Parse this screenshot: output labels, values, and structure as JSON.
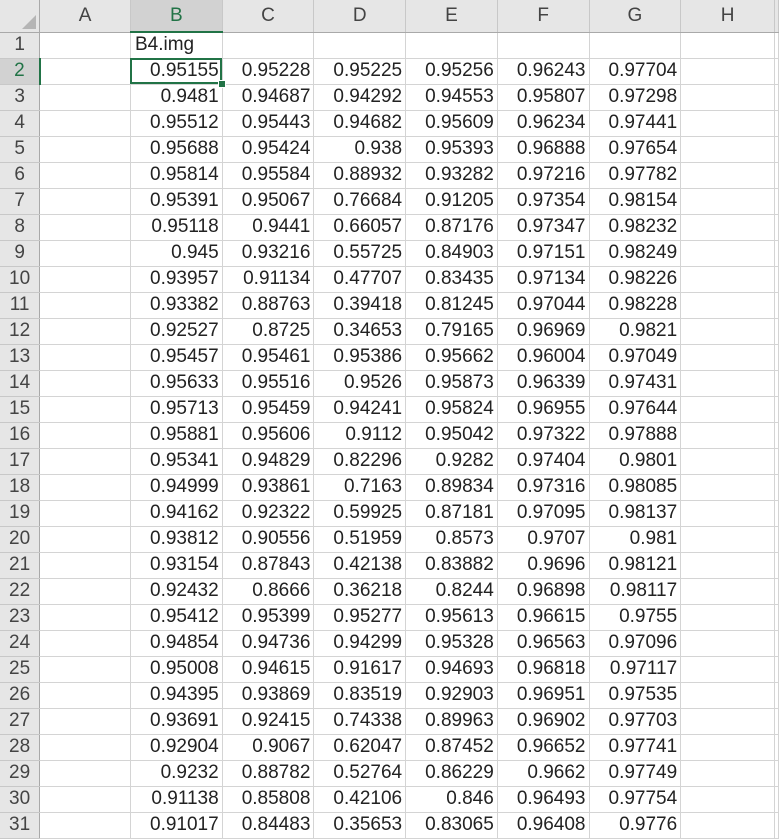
{
  "columns": [
    "A",
    "B",
    "C",
    "D",
    "E",
    "F",
    "G",
    "H"
  ],
  "rows": [
    {
      "num": "1",
      "cells": [
        "",
        "B4.img",
        "",
        "",
        "",
        "",
        "",
        ""
      ]
    },
    {
      "num": "2",
      "cells": [
        "",
        "0.95155",
        "0.95228",
        "0.95225",
        "0.95256",
        "0.96243",
        "0.97704",
        ""
      ]
    },
    {
      "num": "3",
      "cells": [
        "",
        "0.9481",
        "0.94687",
        "0.94292",
        "0.94553",
        "0.95807",
        "0.97298",
        ""
      ]
    },
    {
      "num": "4",
      "cells": [
        "",
        "0.95512",
        "0.95443",
        "0.94682",
        "0.95609",
        "0.96234",
        "0.97441",
        ""
      ]
    },
    {
      "num": "5",
      "cells": [
        "",
        "0.95688",
        "0.95424",
        "0.938",
        "0.95393",
        "0.96888",
        "0.97654",
        ""
      ]
    },
    {
      "num": "6",
      "cells": [
        "",
        "0.95814",
        "0.95584",
        "0.88932",
        "0.93282",
        "0.97216",
        "0.97782",
        ""
      ]
    },
    {
      "num": "7",
      "cells": [
        "",
        "0.95391",
        "0.95067",
        "0.76684",
        "0.91205",
        "0.97354",
        "0.98154",
        ""
      ]
    },
    {
      "num": "8",
      "cells": [
        "",
        "0.95118",
        "0.9441",
        "0.66057",
        "0.87176",
        "0.97347",
        "0.98232",
        ""
      ]
    },
    {
      "num": "9",
      "cells": [
        "",
        "0.945",
        "0.93216",
        "0.55725",
        "0.84903",
        "0.97151",
        "0.98249",
        ""
      ]
    },
    {
      "num": "10",
      "cells": [
        "",
        "0.93957",
        "0.91134",
        "0.47707",
        "0.83435",
        "0.97134",
        "0.98226",
        ""
      ]
    },
    {
      "num": "11",
      "cells": [
        "",
        "0.93382",
        "0.88763",
        "0.39418",
        "0.81245",
        "0.97044",
        "0.98228",
        ""
      ]
    },
    {
      "num": "12",
      "cells": [
        "",
        "0.92527",
        "0.8725",
        "0.34653",
        "0.79165",
        "0.96969",
        "0.9821",
        ""
      ]
    },
    {
      "num": "13",
      "cells": [
        "",
        "0.95457",
        "0.95461",
        "0.95386",
        "0.95662",
        "0.96004",
        "0.97049",
        ""
      ]
    },
    {
      "num": "14",
      "cells": [
        "",
        "0.95633",
        "0.95516",
        "0.9526",
        "0.95873",
        "0.96339",
        "0.97431",
        ""
      ]
    },
    {
      "num": "15",
      "cells": [
        "",
        "0.95713",
        "0.95459",
        "0.94241",
        "0.95824",
        "0.96955",
        "0.97644",
        ""
      ]
    },
    {
      "num": "16",
      "cells": [
        "",
        "0.95881",
        "0.95606",
        "0.9112",
        "0.95042",
        "0.97322",
        "0.97888",
        ""
      ]
    },
    {
      "num": "17",
      "cells": [
        "",
        "0.95341",
        "0.94829",
        "0.82296",
        "0.9282",
        "0.97404",
        "0.9801",
        ""
      ]
    },
    {
      "num": "18",
      "cells": [
        "",
        "0.94999",
        "0.93861",
        "0.7163",
        "0.89834",
        "0.97316",
        "0.98085",
        ""
      ]
    },
    {
      "num": "19",
      "cells": [
        "",
        "0.94162",
        "0.92322",
        "0.59925",
        "0.87181",
        "0.97095",
        "0.98137",
        ""
      ]
    },
    {
      "num": "20",
      "cells": [
        "",
        "0.93812",
        "0.90556",
        "0.51959",
        "0.8573",
        "0.9707",
        "0.981",
        ""
      ]
    },
    {
      "num": "21",
      "cells": [
        "",
        "0.93154",
        "0.87843",
        "0.42138",
        "0.83882",
        "0.9696",
        "0.98121",
        ""
      ]
    },
    {
      "num": "22",
      "cells": [
        "",
        "0.92432",
        "0.8666",
        "0.36218",
        "0.8244",
        "0.96898",
        "0.98117",
        ""
      ]
    },
    {
      "num": "23",
      "cells": [
        "",
        "0.95412",
        "0.95399",
        "0.95277",
        "0.95613",
        "0.96615",
        "0.9755",
        ""
      ]
    },
    {
      "num": "24",
      "cells": [
        "",
        "0.94854",
        "0.94736",
        "0.94299",
        "0.95328",
        "0.96563",
        "0.97096",
        ""
      ]
    },
    {
      "num": "25",
      "cells": [
        "",
        "0.95008",
        "0.94615",
        "0.91617",
        "0.94693",
        "0.96818",
        "0.97117",
        ""
      ]
    },
    {
      "num": "26",
      "cells": [
        "",
        "0.94395",
        "0.93869",
        "0.83519",
        "0.92903",
        "0.96951",
        "0.97535",
        ""
      ]
    },
    {
      "num": "27",
      "cells": [
        "",
        "0.93691",
        "0.92415",
        "0.74338",
        "0.89963",
        "0.96902",
        "0.97703",
        ""
      ]
    },
    {
      "num": "28",
      "cells": [
        "",
        "0.92904",
        "0.9067",
        "0.62047",
        "0.87452",
        "0.96652",
        "0.97741",
        ""
      ]
    },
    {
      "num": "29",
      "cells": [
        "",
        "0.9232",
        "0.88782",
        "0.52764",
        "0.86229",
        "0.9662",
        "0.97749",
        ""
      ]
    },
    {
      "num": "30",
      "cells": [
        "",
        "0.91138",
        "0.85808",
        "0.42106",
        "0.846",
        "0.96493",
        "0.97754",
        ""
      ]
    },
    {
      "num": "31",
      "cells": [
        "",
        "0.91017",
        "0.84483",
        "0.35653",
        "0.83065",
        "0.96408",
        "0.9776",
        ""
      ]
    }
  ],
  "selection": {
    "column": "B",
    "row": "2"
  },
  "colors": {
    "accent": "#217346",
    "header_bg": "#e6e6e6",
    "gridline": "#d4d4d4"
  }
}
